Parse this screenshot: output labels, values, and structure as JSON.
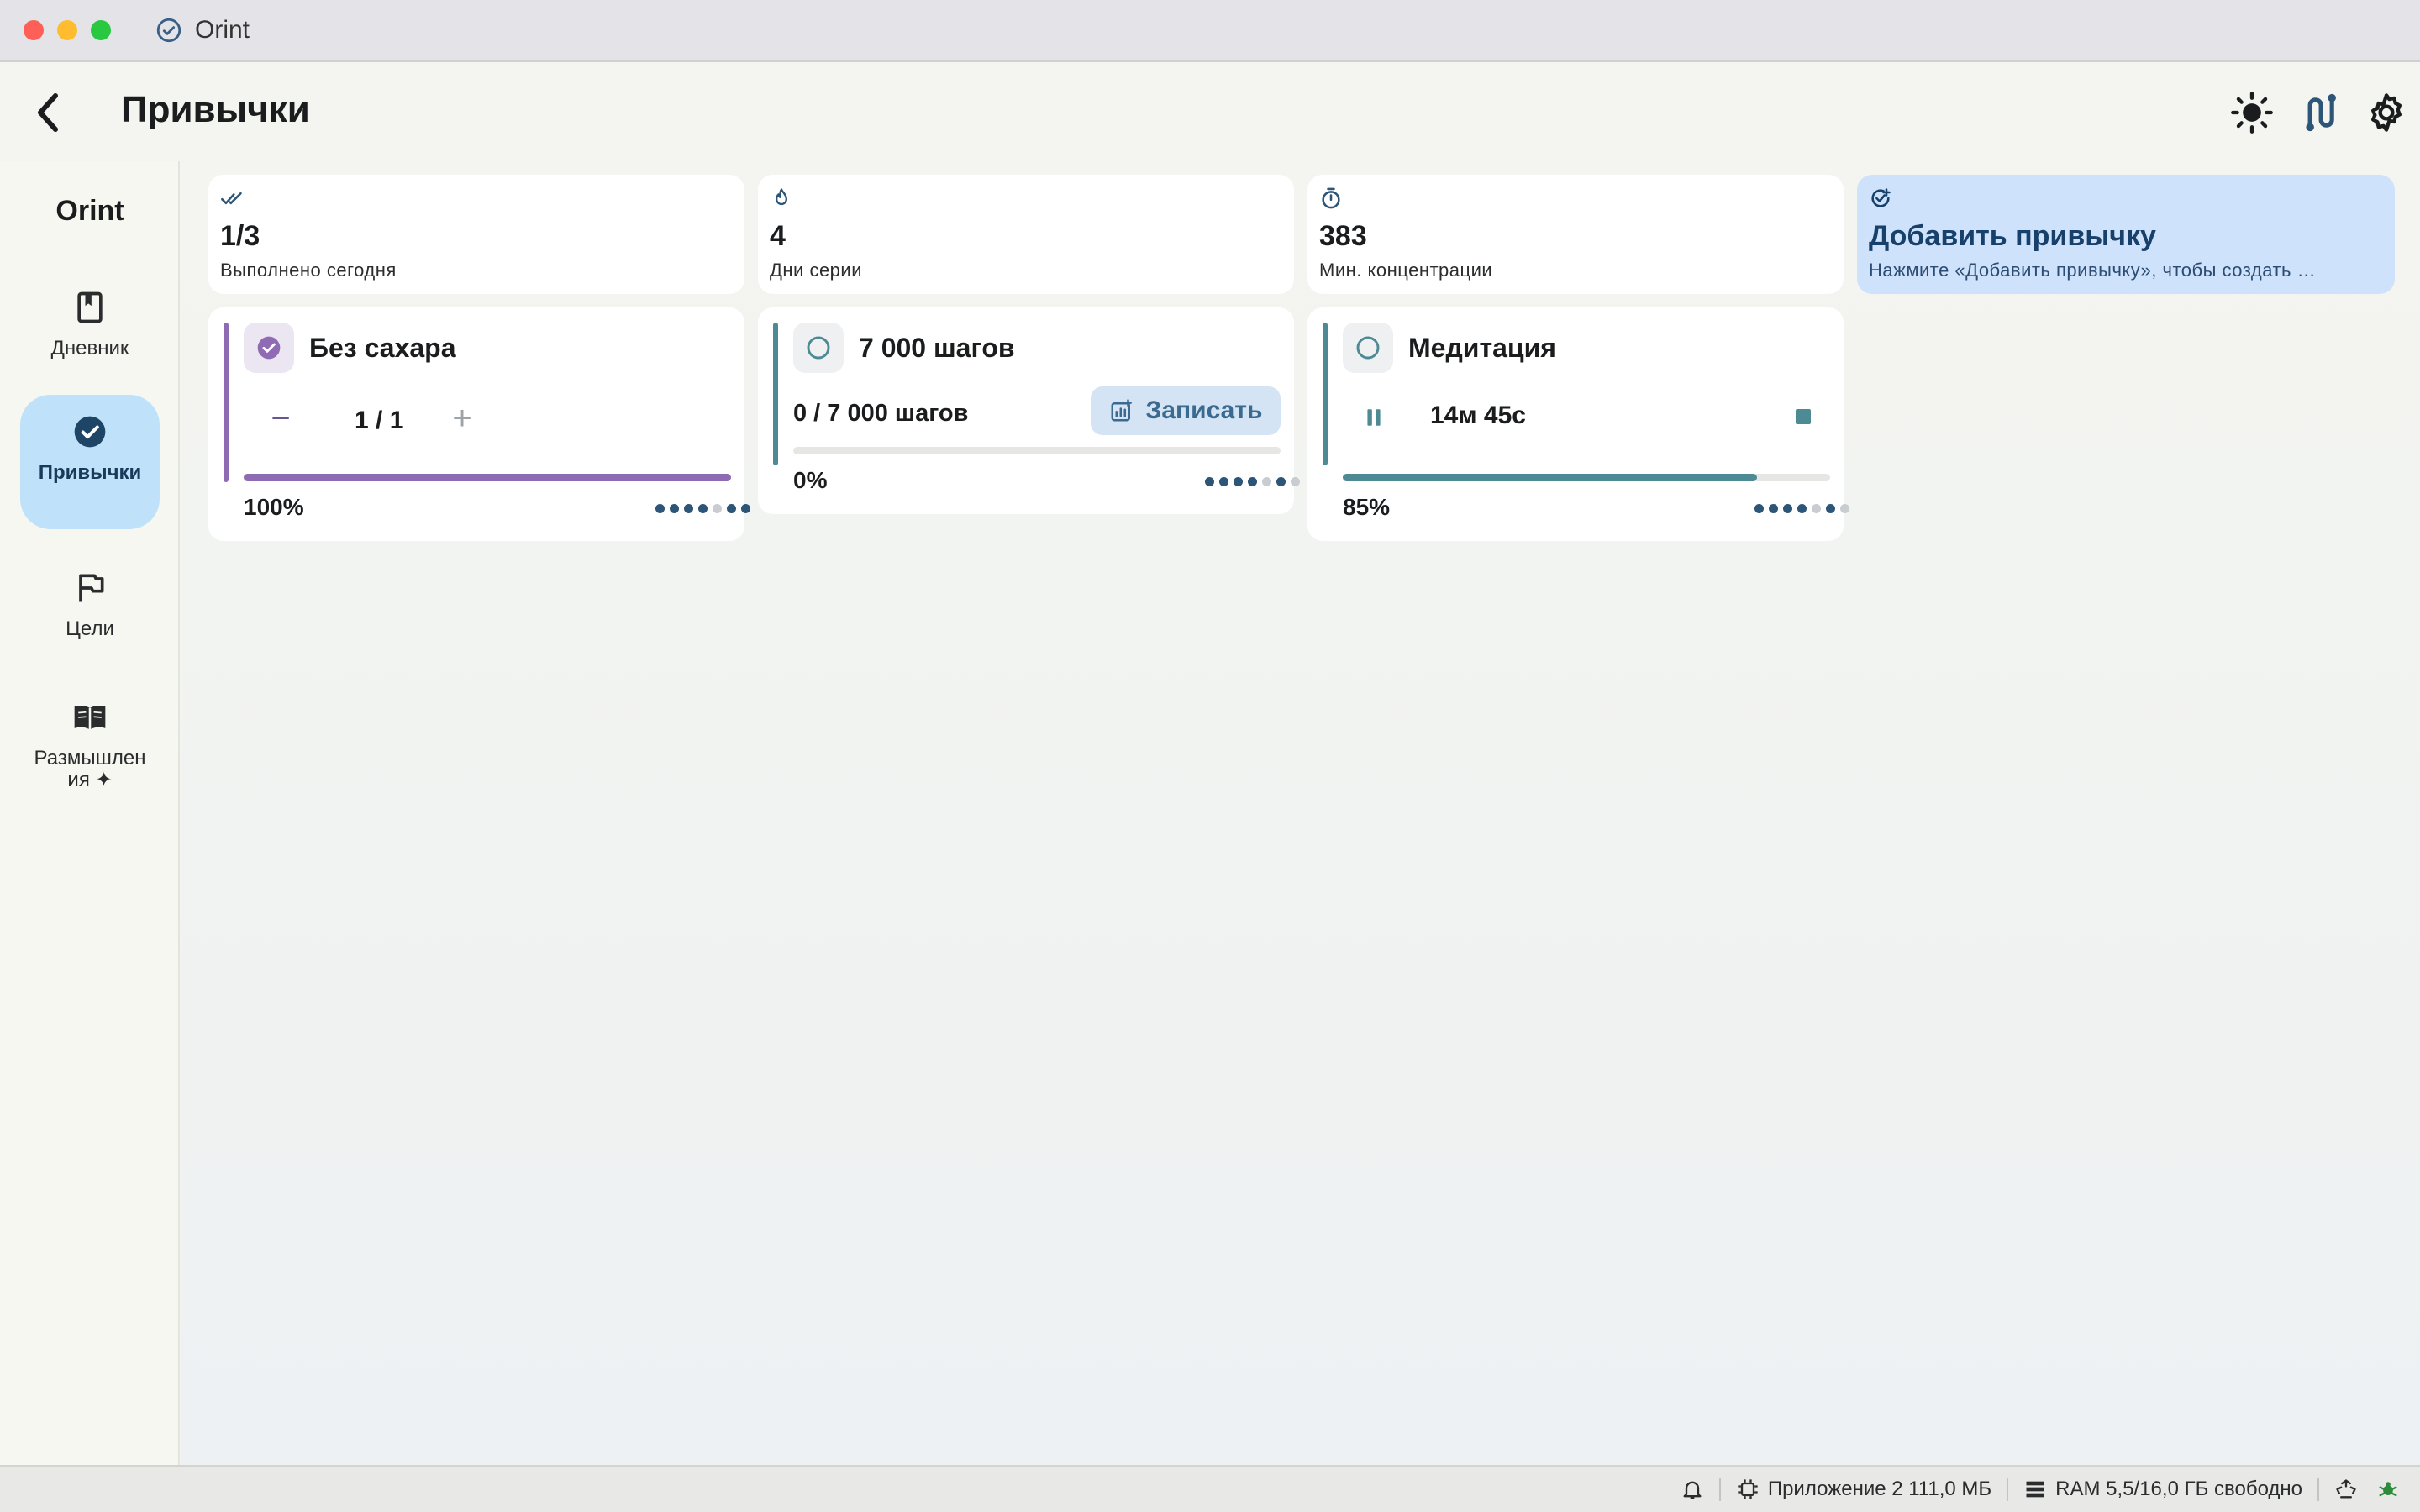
{
  "window": {
    "title": "Orint"
  },
  "header": {
    "title": "Привычки"
  },
  "sidebar": {
    "brand": "Orint",
    "items": [
      {
        "label": "Дневник",
        "icon": "book-icon"
      },
      {
        "label": "Привычки",
        "icon": "check-circle-icon",
        "active": true
      },
      {
        "label": "Цели",
        "icon": "flag-icon"
      },
      {
        "label": "Размышления ✦",
        "icon": "open-book-icon"
      }
    ]
  },
  "stats": [
    {
      "icon": "double-check-icon",
      "value": "1/3",
      "label": "Выполнено сегодня"
    },
    {
      "icon": "flame-icon",
      "value": "4",
      "label": "Дни серии"
    },
    {
      "icon": "timer-icon",
      "value": "383",
      "label": "Мин. концентрации"
    }
  ],
  "add_habit": {
    "title": "Добавить привычку",
    "subtitle": "Нажмите «Добавить привычку», чтобы создать …"
  },
  "habits": [
    {
      "title": "Без сахара",
      "done": true,
      "counter": "1 / 1",
      "minus": "−",
      "plus": "+",
      "progress": 1.0,
      "percent": "100%",
      "accent": "#8e6bb3",
      "dots": [
        1,
        1,
        1,
        1,
        0,
        1,
        1
      ]
    },
    {
      "title": "7 000 шагов",
      "done": false,
      "steps": "0 / 7 000 шагов",
      "record_label": "Записать",
      "progress": 0.0,
      "percent": "0%",
      "accent": "#4e8a93",
      "dots": [
        1,
        1,
        1,
        1,
        0,
        1,
        0
      ]
    },
    {
      "title": "Медитация",
      "done": false,
      "timer": "14м 45с",
      "progress": 0.85,
      "percent": "85%",
      "accent": "#4e8a93",
      "dots": [
        1,
        1,
        1,
        1,
        0,
        1,
        0
      ]
    }
  ],
  "statusbar": {
    "app_memory": "Приложение 2 111,0 МБ",
    "ram": "RAM 5,5/16,0 ГБ свободно"
  },
  "colors": {
    "accent_purple": "#8e6bb3",
    "accent_teal": "#4e8a93",
    "nav_active": "#bfe2fa",
    "add_card": "#cfe2fc"
  }
}
